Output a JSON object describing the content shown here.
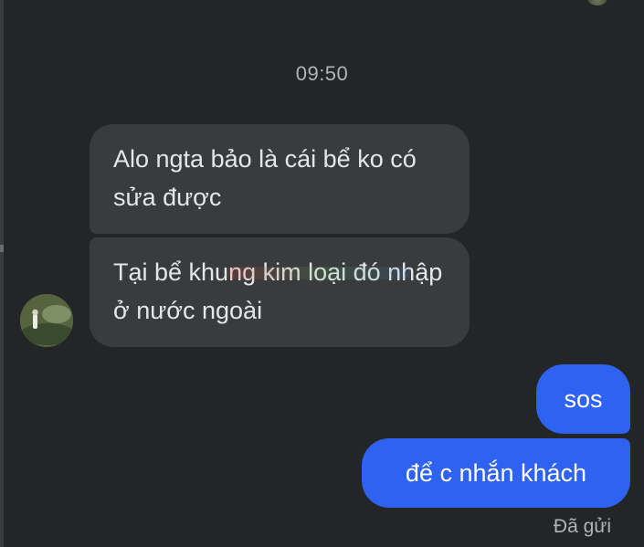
{
  "conversation": {
    "timestamp": "09:50",
    "messages": [
      {
        "direction": "incoming",
        "text": "Alo ngta bảo là cái bể ko có sửa được"
      },
      {
        "direction": "incoming",
        "text": "Tại bể khung kim loại đó nhập ở nước ngoài"
      },
      {
        "direction": "outgoing",
        "text": "sos"
      },
      {
        "direction": "outgoing",
        "text": "để c nhắn khách"
      }
    ],
    "status": "Đã gửi"
  },
  "theme": {
    "background": "#242526",
    "incoming_bubble": "#3a3b3c",
    "outgoing_bubble": "#2e62f0",
    "text_primary": "#e4e6eb",
    "text_secondary": "#b0b3b8"
  },
  "icons": {
    "contact_avatar": "contact-avatar",
    "corner_avatar": "seen-avatar"
  }
}
